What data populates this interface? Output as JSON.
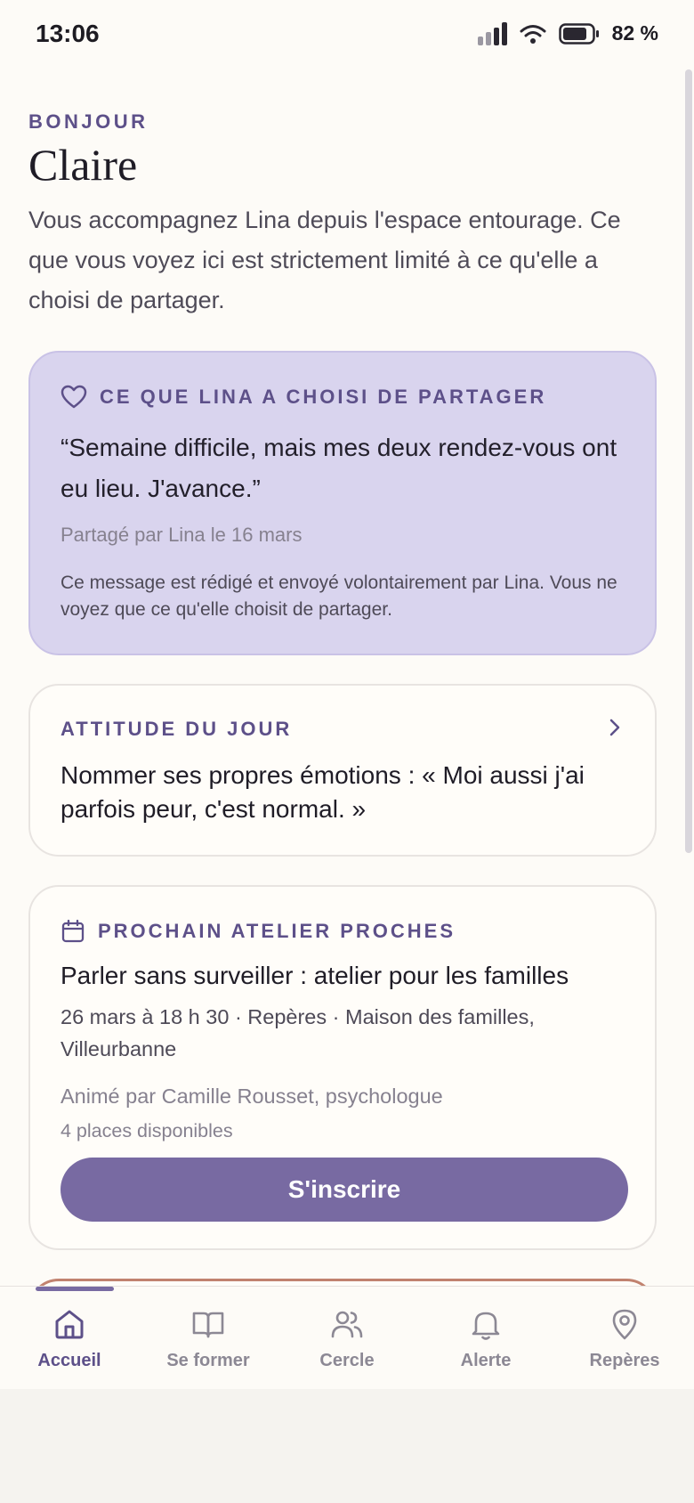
{
  "status_bar": {
    "time": "13:06",
    "battery_percent": "82 %",
    "battery_level": 0.82,
    "icons": [
      "signal-icon",
      "wifi-icon",
      "battery-icon"
    ]
  },
  "header": {
    "greeting": "BONJOUR",
    "name": "Claire",
    "intro": "Vous accompagnez Lina depuis l'espace entourage. Ce que vous voyez ici est strictement limité à ce qu'elle a choisi de partager."
  },
  "shared_card": {
    "icon": "heart-icon",
    "label": "CE QUE LINA A CHOISI DE PARTAGER",
    "quote": "“Semaine difficile, mais mes deux rendez-vous ont eu lieu. J'avance.”",
    "meta": "Partagé par Lina le 16 mars",
    "note": "Ce message est rédigé et envoyé volontairement par Lina. Vous ne voyez que ce qu'elle choisit de partager."
  },
  "attitude_card": {
    "label": "ATTITUDE DU JOUR",
    "icon": "chevron-right-icon",
    "text": "Nommer ses propres émotions : « Moi aussi j'ai parfois peur, c'est normal. »"
  },
  "workshop_card": {
    "icon": "calendar-icon",
    "label": "PROCHAIN ATELIER PROCHES",
    "title": "Parler sans surveiller : atelier pour les familles",
    "details": "26 mars à 18 h 30 · Repères · Maison des familles, Villeurbanne",
    "host": "Animé par Camille Rousset, psychologue",
    "places": "4 places disponibles",
    "button_label": "S'inscrire"
  },
  "bottom_nav": {
    "active": "Accueil",
    "items": [
      {
        "label": "Accueil",
        "icon": "home-icon"
      },
      {
        "label": "Se former",
        "icon": "book-icon"
      },
      {
        "label": "Cercle",
        "icon": "users-icon"
      },
      {
        "label": "Alerte",
        "icon": "bell-icon"
      },
      {
        "label": "Repères",
        "icon": "map-pin-icon"
      }
    ]
  },
  "colors": {
    "accent": "#5d5089",
    "button": "#786aa2",
    "shared_bg": "#d9d4ee",
    "peek_border": "#c1826f",
    "background": "#fdfbf7"
  }
}
